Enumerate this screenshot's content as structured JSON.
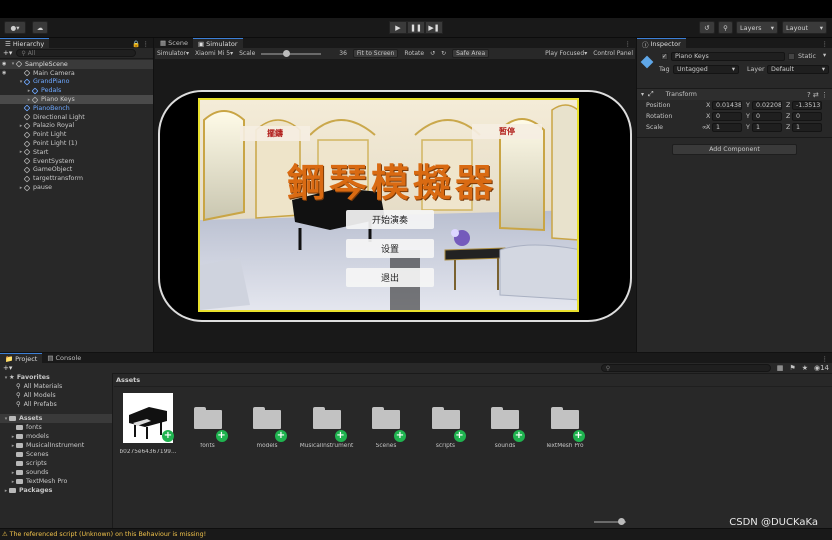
{
  "toolbar": {
    "layers_label": "Layers",
    "layout_label": "Layout"
  },
  "hierarchy": {
    "tab_label": "Hierarchy",
    "search_placeholder": "All",
    "items": [
      {
        "label": "SampleScene",
        "depth": 0,
        "type": "scene"
      },
      {
        "label": "Main Camera",
        "depth": 1
      },
      {
        "label": "GrandPiano",
        "depth": 1,
        "blue": true,
        "expanded": true
      },
      {
        "label": "Pedals",
        "depth": 2,
        "blue": true
      },
      {
        "label": "Piano Keys",
        "depth": 2,
        "selected": true
      },
      {
        "label": "PianoBench",
        "depth": 1,
        "blue": true
      },
      {
        "label": "Directional Light",
        "depth": 1
      },
      {
        "label": "Palazio Royal",
        "depth": 1
      },
      {
        "label": "Point Light",
        "depth": 1
      },
      {
        "label": "Point Light (1)",
        "depth": 1
      },
      {
        "label": "Start",
        "depth": 1
      },
      {
        "label": "EventSystem",
        "depth": 1
      },
      {
        "label": "GameObject",
        "depth": 1
      },
      {
        "label": "targettransform",
        "depth": 1
      },
      {
        "label": "pause",
        "depth": 1
      }
    ]
  },
  "scene": {
    "tabs": [
      "Scene",
      "Simulator"
    ],
    "simulator_label": "Simulator",
    "device_label": "Xiaomi Mi 5",
    "scale_label": "Scale",
    "scale_value": "36",
    "fit_label": "Fit to Screen",
    "rotate_label": "Rotate",
    "safe_area_label": "Safe Area",
    "play_focused_label": "Play Focused",
    "control_panel_label": "Control Panel"
  },
  "game": {
    "title": "鋼琴模擬器",
    "top_left_button": "擺鑄",
    "top_right_button": "暂停",
    "menu_buttons": [
      "开始演奏",
      "设置",
      "退出"
    ]
  },
  "inspector": {
    "tab_label": "Inspector",
    "object_name": "Piano Keys",
    "static_label": "Static",
    "tag_label": "Tag",
    "tag_value": "Untagged",
    "layer_label": "Layer",
    "layer_value": "Default",
    "transform_label": "Transform",
    "position": {
      "label": "Position",
      "x": "0.01438",
      "y": "0.02208",
      "z": "-1.3513"
    },
    "rotation": {
      "label": "Rotation",
      "x": "0",
      "y": "0",
      "z": "0"
    },
    "scale": {
      "label": "Scale",
      "x": "1",
      "y": "1",
      "z": "1"
    },
    "add_component_label": "Add Component"
  },
  "project": {
    "tabs": [
      "Project",
      "Console"
    ],
    "badge_count": "14",
    "favorites_label": "Favorites",
    "favorites": [
      "All Materials",
      "All Models",
      "All Prefabs"
    ],
    "assets_label": "Assets",
    "asset_tree": [
      "fonts",
      "models",
      "MusicalInstrument",
      "Scenes",
      "scripts",
      "sounds",
      "TextMesh Pro"
    ],
    "packages_label": "Packages",
    "breadcrumb": "Assets",
    "assets": [
      "b0275e64367199...",
      "fonts",
      "models",
      "MusicalInstrument",
      "Scenes",
      "scripts",
      "sounds",
      "TextMesh Pro"
    ]
  },
  "status": {
    "message": "The referenced script (Unknown) on this Behaviour is missing!"
  },
  "watermark": "CSDN @DUCKaKa"
}
